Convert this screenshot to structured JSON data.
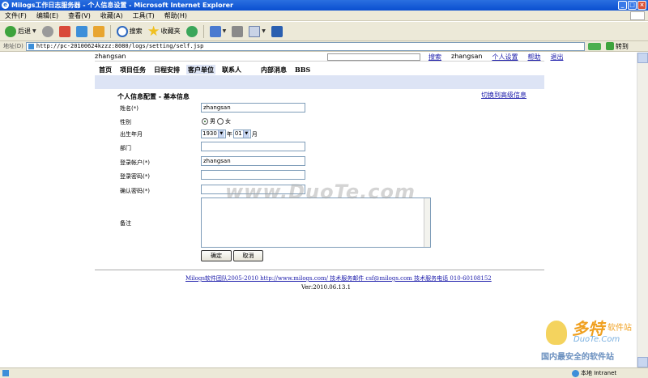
{
  "window": {
    "title": "Milogs工作日志服务器 - 个人信息设置 - Microsoft Internet Explorer",
    "icon": "ie-icon"
  },
  "menu": [
    "文件(F)",
    "编辑(E)",
    "查看(V)",
    "收藏(A)",
    "工具(T)",
    "帮助(H)"
  ],
  "toolbar": {
    "back": "后退",
    "search": "搜索",
    "favorites": "收藏夹"
  },
  "address": {
    "label": "地址(D)",
    "url": "http://pc-20100624kzzz:8080/logs/setting/self.jsp",
    "go": "转到"
  },
  "header": {
    "username": "zhangsan",
    "search_link": "搜索",
    "user": "zhangsan",
    "settings_link": "个人设置",
    "help_link": "帮助",
    "logout_link": "退出"
  },
  "nav": [
    {
      "label": "首页",
      "active": false
    },
    {
      "label": "项目任务",
      "active": false
    },
    {
      "label": "日程安排",
      "active": false
    },
    {
      "label": "客户单位",
      "active": true
    },
    {
      "label": "联系人",
      "active": false
    },
    {
      "label": "内部消息",
      "active": false
    },
    {
      "label": "BBS",
      "active": false
    }
  ],
  "form": {
    "title": "个人信息配置 - 基本信息",
    "switch_link": "切换到高级信息",
    "name_label": "姓名(*)",
    "name_value": "zhangsan",
    "gender_label": "性别",
    "gender_male": "男",
    "gender_female": "女",
    "gender_selected": "男",
    "birth_label": "出生年月",
    "birth_year": "1930",
    "year_unit": "年",
    "birth_month": "01",
    "month_unit": "月",
    "dept_label": "部门",
    "dept_value": "",
    "login_label": "登录帐户(*)",
    "login_value": "zhangsan",
    "password_label": "登录密码(*)",
    "confirm_label": "确认密码(*)",
    "note_label": "备注",
    "ok_button": "确定",
    "cancel_button": "取消"
  },
  "footer": {
    "links": "Milogs软件团队2005-2010  http://www.milogs.com/  技术服务邮件  csf@milogs.com  技术服务电话 010-60108152",
    "version": "Ver:2010.06.13.1"
  },
  "watermarks": {
    "center": "www.DuoTe.com",
    "brand": "多特",
    "brand_sub": "软件站",
    "brand_en": "DuoTe.Com",
    "slogan": "国内最安全的软件站"
  },
  "status": {
    "zone": "本地 Intranet"
  }
}
